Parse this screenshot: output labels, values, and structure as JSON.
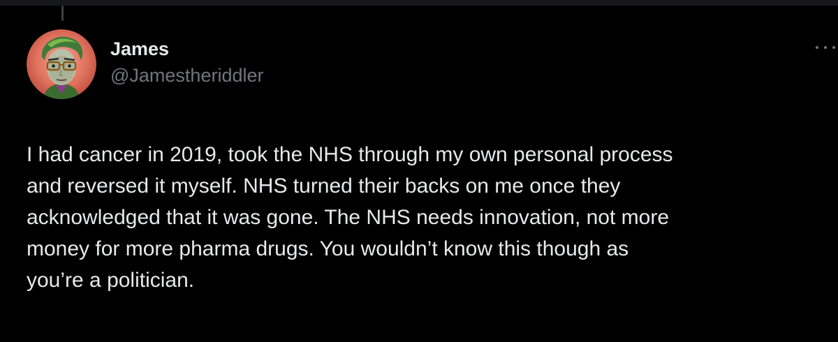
{
  "author": {
    "display_name": "James",
    "handle": "@Jamestheriddler",
    "avatar_icon": "profile-avatar"
  },
  "tweet": {
    "lines": [
      "I had cancer in 2019, took the NHS through my own personal process",
      "and reversed it myself. NHS turned their backs on me once they",
      "acknowledged that it was gone. The NHS needs innovation, not more",
      "money for more pharma drugs. You wouldn’t know this though as",
      "you’re a politician."
    ]
  },
  "actions": {
    "more_icon": "more-horizontal-icon"
  },
  "colors": {
    "background": "#000000",
    "text_primary": "#e7e9ea",
    "text_secondary": "#71767b",
    "thread_line": "#3e4144"
  }
}
